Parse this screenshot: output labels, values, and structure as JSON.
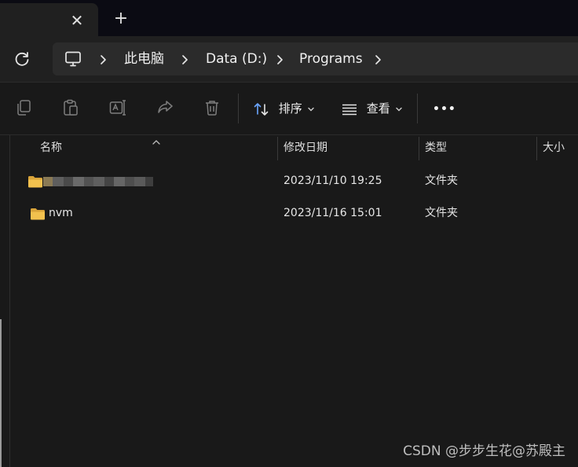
{
  "tabbar": {
    "close_glyph": "✕",
    "new_tab_glyph": "+"
  },
  "addressbar": {
    "icons": [
      "refresh-icon",
      "this-pc-icon",
      "chevron-right-icon"
    ],
    "breadcrumbs": [
      "此电脑",
      "Data (D:)",
      "Programs"
    ]
  },
  "toolbar": {
    "icons": [
      "copy-icon",
      "paste-icon",
      "rename-icon",
      "share-icon",
      "delete-icon",
      "sort-icon",
      "view-icon",
      "more-icon"
    ],
    "sort_label": "排序",
    "view_label": "查看",
    "more_glyph": "•••"
  },
  "columns": {
    "name": "名称",
    "modified": "修改日期",
    "type": "类型",
    "size": "大小"
  },
  "rows": [
    {
      "name": "",
      "name_obscured": true,
      "modified": "2023/11/10 19:25",
      "type": "文件夹"
    },
    {
      "name": "nvm",
      "name_obscured": false,
      "modified": "2023/11/16 15:01",
      "type": "文件夹"
    }
  ],
  "watermark": "CSDN @步步生花@苏殿主",
  "colors": {
    "background": "#191919",
    "chrome": "#202020",
    "tabstrip": "#0b0b13",
    "folder": "#f2c14e"
  }
}
